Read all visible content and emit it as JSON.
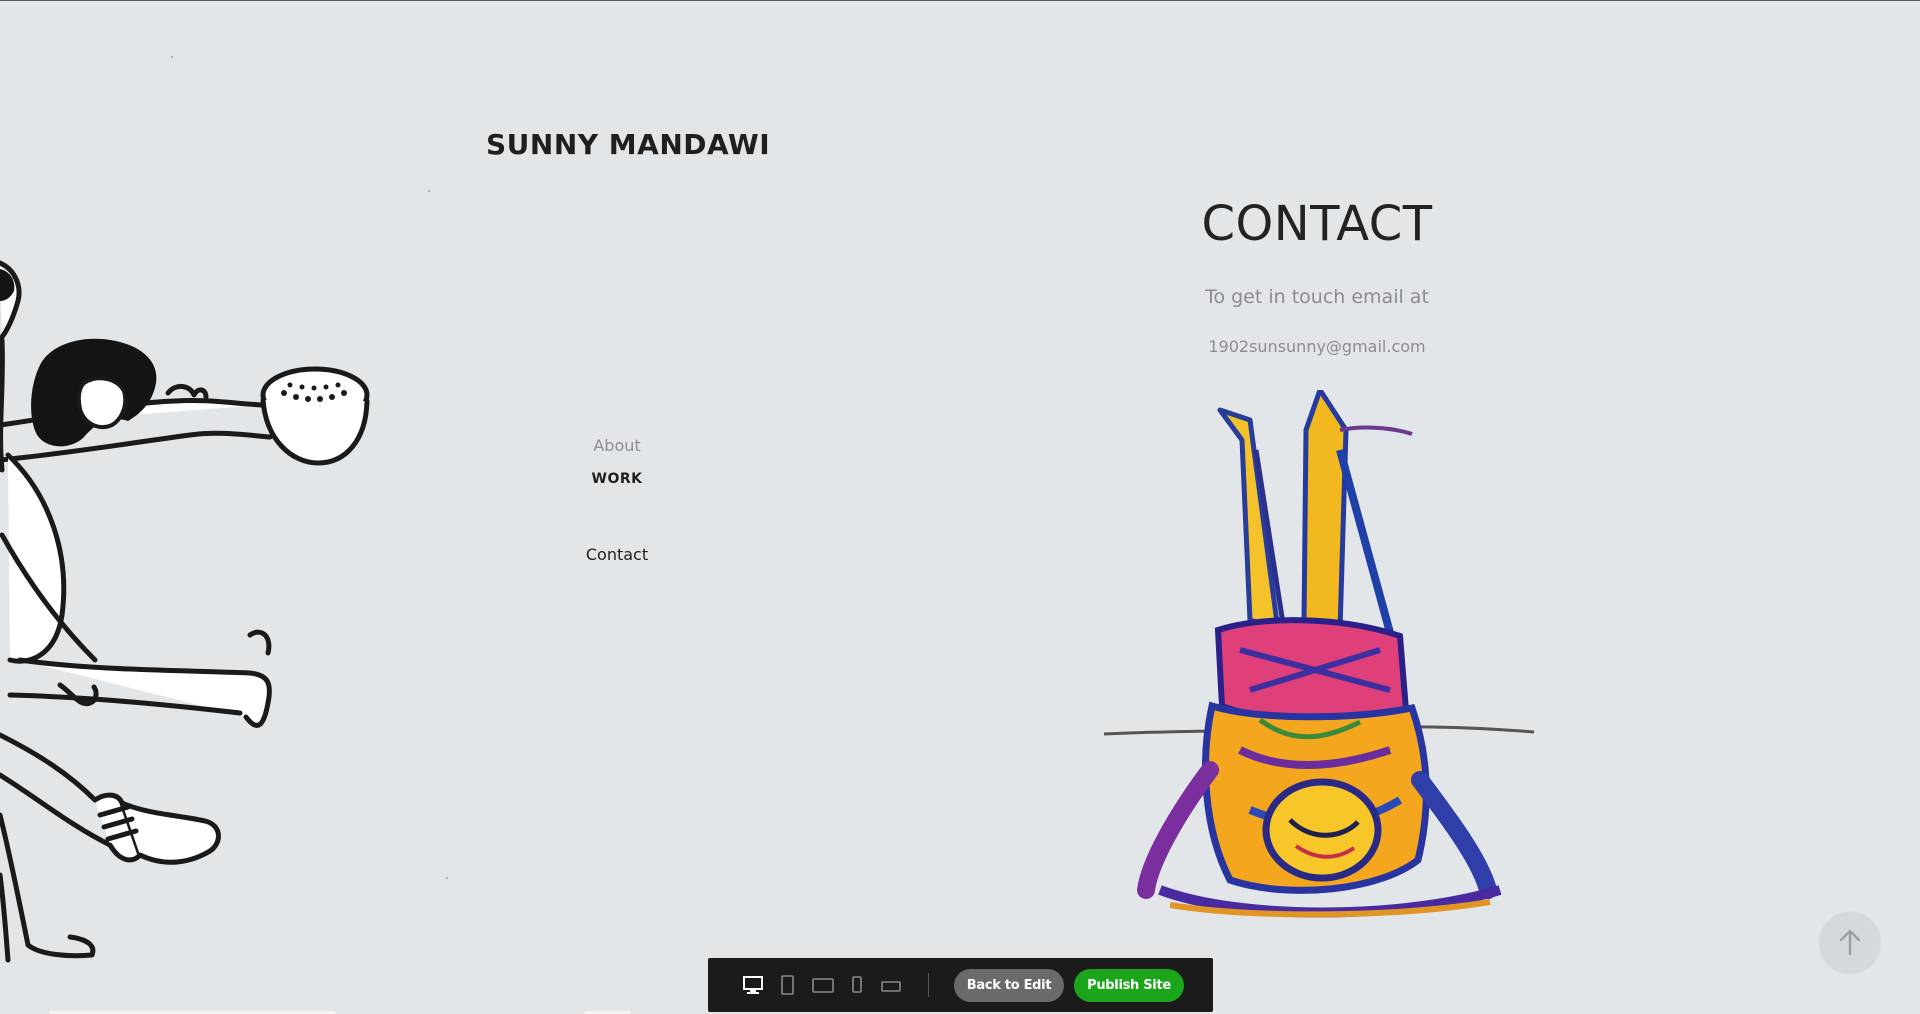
{
  "site": {
    "title": "SUNNY MANDAWI"
  },
  "nav": {
    "items": [
      "About",
      "WORK",
      "Contact"
    ]
  },
  "contact": {
    "heading": "CONTACT",
    "intro": "To get in touch email at",
    "email": "1902sunsunny@gmail.com"
  },
  "editor": {
    "devices": [
      "desktop-icon",
      "tablet-portrait-icon",
      "tablet-landscape-icon",
      "mobile-portrait-icon",
      "mobile-landscape-icon"
    ],
    "back_label": "Back to Edit",
    "publish_label": "Publish Site"
  },
  "colors": {
    "background": "#e3e6e9",
    "publish": "#1aa51a",
    "back": "#6a6a6a",
    "toolbar": "#1b1b1b"
  },
  "icons": {
    "scroll_top": "arrow-up-icon"
  }
}
